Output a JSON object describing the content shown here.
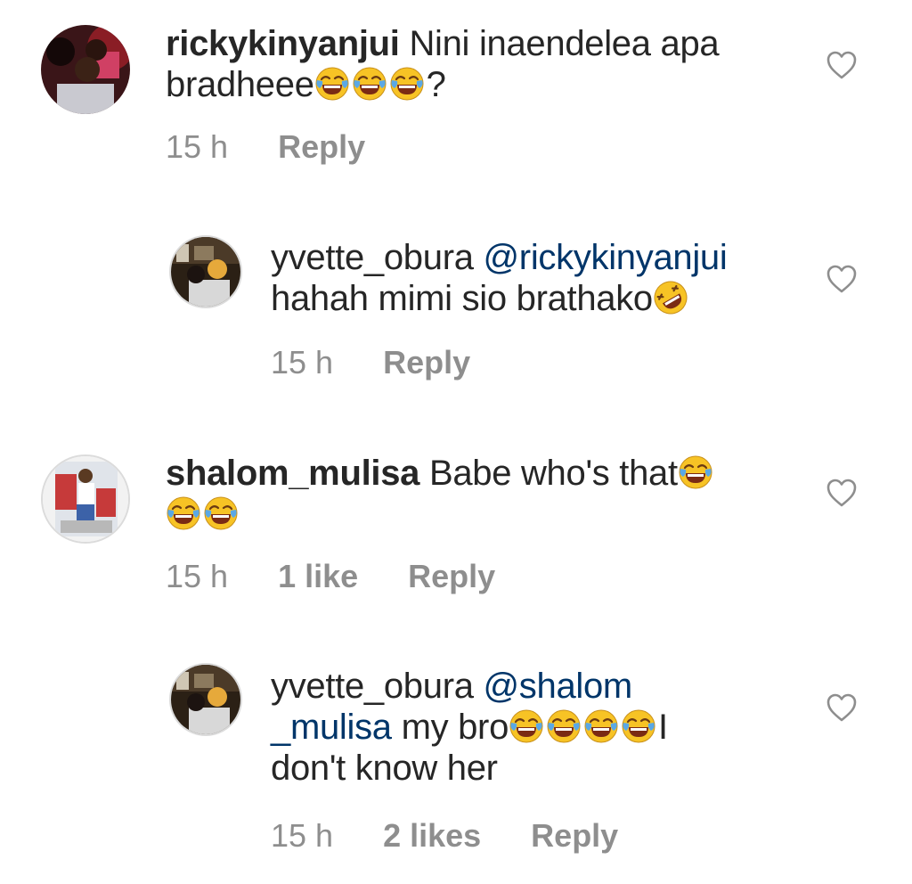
{
  "comments": [
    {
      "username": "rickykinyanjui",
      "text_before": "Nini inaendelea apa bradheee",
      "emoji_count": 3,
      "text_after": "?",
      "time": "15 h",
      "reply_label": "Reply"
    },
    {
      "username": "yvette_obura",
      "mention": "@rickykinyanjui",
      "text": "hahah mimi sio brathako",
      "time": "15 h",
      "reply_label": "Reply"
    },
    {
      "username": "shalom_mulisa",
      "text": "Babe who's that",
      "time": "15 h",
      "likes": "1 like",
      "reply_label": "Reply"
    },
    {
      "username": "yvette_obura",
      "mention_line1": "@shalom",
      "mention_line2": "_mulisa",
      "text_mid": "my bro",
      "text_end_a": "I",
      "text_end_b": "don't know her",
      "time": "15 h",
      "likes": "2 likes",
      "reply_label": "Reply"
    }
  ],
  "icons": {
    "like": "heart-outline-icon",
    "emoji_laugh": "face-with-tears-of-joy",
    "emoji_rofl": "rolling-on-floor-laughing"
  },
  "colors": {
    "text": "#262626",
    "meta": "#8e8e8e",
    "mention": "#003569"
  }
}
